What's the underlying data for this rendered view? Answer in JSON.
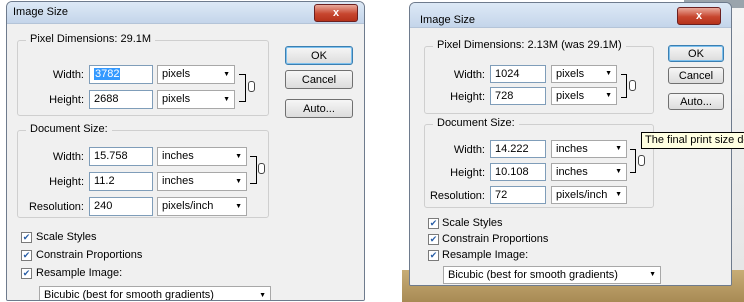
{
  "dialog_before": {
    "title": "Image Size",
    "close_glyph": "x",
    "pixel_dimensions": {
      "legend": "Pixel Dimensions:  29.1M",
      "width_label": "Width:",
      "width_value": "3782",
      "width_unit": "pixels",
      "height_label": "Height:",
      "height_value": "2688",
      "height_unit": "pixels"
    },
    "buttons": {
      "ok": "OK",
      "cancel": "Cancel",
      "auto": "Auto..."
    },
    "document_size": {
      "legend": "Document Size:",
      "width_label": "Width:",
      "width_value": "15.758",
      "width_unit": "inches",
      "height_label": "Height:",
      "height_value": "11.2",
      "height_unit": "inches",
      "resolution_label": "Resolution:",
      "resolution_value": "240",
      "resolution_unit": "pixels/inch"
    },
    "options": {
      "scale_styles": "Scale Styles",
      "constrain_proportions": "Constrain Proportions",
      "resample_image": "Resample Image:",
      "resample_method": "Bicubic (best for smooth gradients)"
    }
  },
  "dialog_after": {
    "title": "Image Size",
    "close_glyph": "x",
    "pixel_dimensions": {
      "legend": "Pixel Dimensions:  2.13M (was 29.1M)",
      "width_label": "Width:",
      "width_value": "1024",
      "width_unit": "pixels",
      "height_label": "Height:",
      "height_value": "728",
      "height_unit": "pixels"
    },
    "buttons": {
      "ok": "OK",
      "cancel": "Cancel",
      "auto": "Auto..."
    },
    "document_size": {
      "legend": "Document Size:",
      "width_label": "Width:",
      "width_value": "14.222",
      "width_unit": "inches",
      "height_label": "Height:",
      "height_value": "10.108",
      "height_unit": "inches",
      "resolution_label": "Resolution:",
      "resolution_value": "72",
      "resolution_unit": "pixels/inch"
    },
    "options": {
      "scale_styles": "Scale Styles",
      "constrain_proportions": "Constrain Proportions",
      "resample_image": "Resample Image:",
      "resample_method": "Bicubic (best for smooth gradients)"
    },
    "tooltip": "The final print size depen"
  },
  "colors": {
    "title_bar": "#c4d5ea",
    "dialog_bg": "#f0f0f0",
    "close_button": "#c7462f",
    "selection": "#3399ff",
    "tooltip_bg": "#ffffe1",
    "desktop_ground": "#b89a62"
  },
  "icons": [
    "close-icon",
    "chain-link-icon",
    "dropdown-arrow-icon",
    "checkmark-icon"
  ]
}
